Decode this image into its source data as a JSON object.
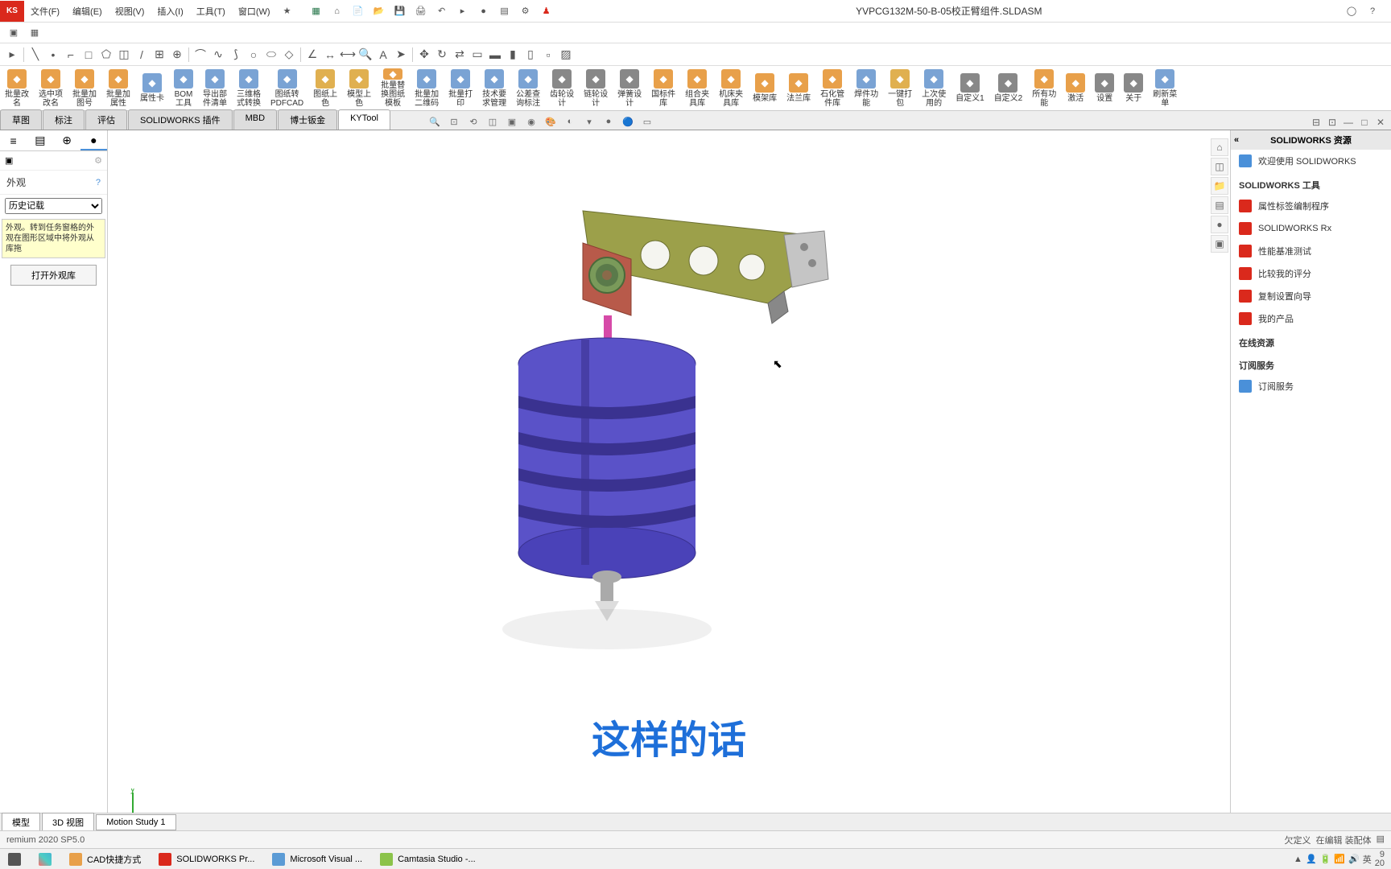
{
  "app": {
    "logo": "KS",
    "title": "YVPCG132M-50-B-05校正臂组件.SLDASM"
  },
  "menu": [
    "文件(F)",
    "编辑(E)",
    "视图(V)",
    "插入(I)",
    "工具(T)",
    "窗口(W)"
  ],
  "ribbon": [
    {
      "lbl": "批量改\n名",
      "c": "#e8a04a"
    },
    {
      "lbl": "选中项\n改名",
      "c": "#e8a04a"
    },
    {
      "lbl": "批量加\n图号",
      "c": "#e8a04a"
    },
    {
      "lbl": "批量加\n属性",
      "c": "#e8a04a"
    },
    {
      "lbl": "属性卡",
      "c": "#7aa3d4"
    },
    {
      "lbl": "BOM\n工具",
      "c": "#7aa3d4"
    },
    {
      "lbl": "导出部\n件清单",
      "c": "#7aa3d4"
    },
    {
      "lbl": "三维格\n式转换",
      "c": "#7aa3d4"
    },
    {
      "lbl": "图纸转\nPDFCAD",
      "c": "#7aa3d4"
    },
    {
      "lbl": "图纸上\n色",
      "c": "#e0b050"
    },
    {
      "lbl": "模型上\n色",
      "c": "#e0b050"
    },
    {
      "lbl": "批量替\n换图纸\n模板",
      "c": "#e8a04a"
    },
    {
      "lbl": "批量加\n二维码",
      "c": "#7aa3d4"
    },
    {
      "lbl": "批量打\n印",
      "c": "#7aa3d4"
    },
    {
      "lbl": "技术要\n求管理",
      "c": "#7aa3d4"
    },
    {
      "lbl": "公差查\n询标注",
      "c": "#7aa3d4"
    },
    {
      "lbl": "齿轮设\n计",
      "c": "#888"
    },
    {
      "lbl": "链轮设\n计",
      "c": "#888"
    },
    {
      "lbl": "弹簧设\n计",
      "c": "#888"
    },
    {
      "lbl": "国标件\n库",
      "c": "#e8a04a"
    },
    {
      "lbl": "组合夹\n具库",
      "c": "#e8a04a"
    },
    {
      "lbl": "机床夹\n具库",
      "c": "#e8a04a"
    },
    {
      "lbl": "模架库",
      "c": "#e8a04a"
    },
    {
      "lbl": "法兰库",
      "c": "#e8a04a"
    },
    {
      "lbl": "石化管\n件库",
      "c": "#e8a04a"
    },
    {
      "lbl": "焊件功\n能",
      "c": "#7aa3d4"
    },
    {
      "lbl": "一键打\n包",
      "c": "#e0b050"
    },
    {
      "lbl": "上次使\n用的",
      "c": "#7aa3d4"
    },
    {
      "lbl": "自定义1",
      "c": "#888"
    },
    {
      "lbl": "自定义2",
      "c": "#888"
    },
    {
      "lbl": "所有功\n能",
      "c": "#e8a04a"
    },
    {
      "lbl": "激活",
      "c": "#e8a04a"
    },
    {
      "lbl": "设置",
      "c": "#888"
    },
    {
      "lbl": "关于",
      "c": "#888"
    },
    {
      "lbl": "刷新菜\n单",
      "c": "#7aa3d4"
    }
  ],
  "tabs": [
    "草图",
    "标注",
    "评估",
    "SOLIDWORKS 插件",
    "MBD",
    "博士钣金",
    "KYTool"
  ],
  "activeTab": "KYTool",
  "leftPanel": {
    "title": "外观",
    "history": "历史记载",
    "hint": "外观。转到任务窗格的外观在图形区域中将外观从库拖",
    "openLib": "打开外观库"
  },
  "rightPanel": {
    "title": "SOLIDWORKS 资源",
    "welcome": "欢迎使用 SOLIDWORKS",
    "section1": "SOLIDWORKS 工具",
    "items1": [
      "属性标签编制程序",
      "SOLIDWORKS Rx",
      "性能基准测试",
      "比较我的评分",
      "复制设置向导",
      "我的产品"
    ],
    "section2": "在线资源",
    "section3": "订阅服务",
    "items3": [
      "订阅服务"
    ]
  },
  "bottomTabs": [
    "模型",
    "3D 视图",
    "Motion Study 1"
  ],
  "status": {
    "left": "remium 2020 SP5.0",
    "r1": "欠定义",
    "r2": "在编辑 装配体"
  },
  "taskbar": [
    {
      "lbl": "",
      "ico": "#555"
    },
    {
      "lbl": "",
      "ico": "linear-gradient(45deg,#ff6b6b,#4ecdc4,#45b7d1)"
    },
    {
      "lbl": "CAD快捷方式",
      "ico": "#e8a04a"
    },
    {
      "lbl": "SOLIDWORKS Pr...",
      "ico": "#da291c"
    },
    {
      "lbl": "Microsoft Visual ...",
      "ico": "#5b9bd5"
    },
    {
      "lbl": "Camtasia Studio -...",
      "ico": "#8bc34a"
    }
  ],
  "tray": {
    "time": "9",
    "date": "20",
    "lang": "英"
  },
  "caption": "这样的话"
}
